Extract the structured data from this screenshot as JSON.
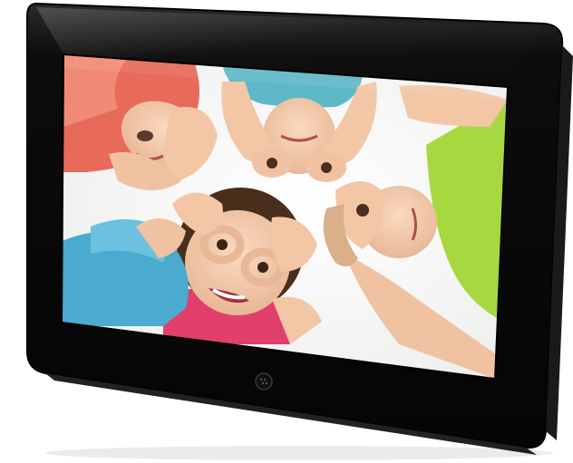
{
  "product": {
    "name": "digital-photo-frame",
    "frame_color": "#0b0b0b",
    "bezel_highlight": "#3a3a3a",
    "button_icon": "speaker-grille-icon"
  },
  "screen": {
    "content": "photo",
    "subjects": [
      {
        "id": "child-top-left",
        "shirt_color": "#e86a5a"
      },
      {
        "id": "child-top",
        "shirt_color": "#5fb8c8"
      },
      {
        "id": "child-right",
        "shirt_color": "#a8d840"
      },
      {
        "id": "child-bottom",
        "shirt_color": "#e0406a"
      },
      {
        "id": "child-left",
        "shirt_color": "#4aaad0"
      }
    ],
    "sky_color": "#f7f7f5"
  }
}
